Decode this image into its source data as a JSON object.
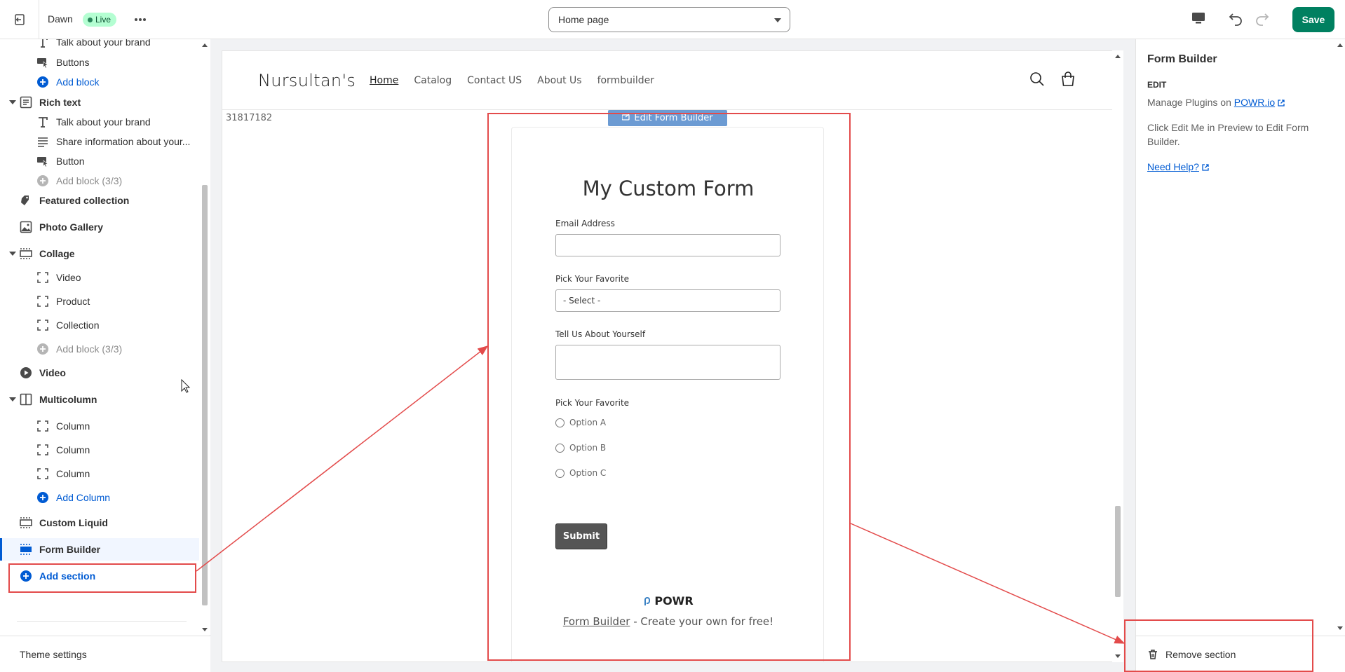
{
  "topbar": {
    "theme_name": "Dawn",
    "live_badge": "Live",
    "page_selector": "Home page",
    "save_label": "Save"
  },
  "sidebar": {
    "items": [
      {
        "label": "Talk about your brand",
        "icon": "text-heading-icon",
        "level": 1
      },
      {
        "label": "Buttons",
        "icon": "button-icon",
        "level": 1
      },
      {
        "label": "Add block",
        "icon": "add-circle-icon",
        "level": 1,
        "kind": "add"
      },
      {
        "label": "Rich text",
        "icon": "rich-text-icon",
        "level": 0,
        "expanded": true
      },
      {
        "label": "Talk about your brand",
        "icon": "text-heading-icon",
        "level": 1
      },
      {
        "label": "Share information about your...",
        "icon": "paragraph-icon",
        "level": 1
      },
      {
        "label": "Button",
        "icon": "button-icon",
        "level": 1
      },
      {
        "label": "Add block (3/3)",
        "icon": "add-circle-icon",
        "level": 1,
        "kind": "disabled"
      },
      {
        "label": "Featured collection",
        "icon": "collection-icon",
        "level": 0
      },
      {
        "label": "Photo Gallery",
        "icon": "image-icon",
        "level": 0
      },
      {
        "label": "Collage",
        "icon": "section-icon",
        "level": 0,
        "expanded": true
      },
      {
        "label": "Video",
        "icon": "block-icon",
        "level": 1
      },
      {
        "label": "Product",
        "icon": "block-icon",
        "level": 1
      },
      {
        "label": "Collection",
        "icon": "block-icon",
        "level": 1
      },
      {
        "label": "Add block (3/3)",
        "icon": "add-circle-icon",
        "level": 1,
        "kind": "disabled"
      },
      {
        "label": "Video",
        "icon": "play-icon",
        "level": 0
      },
      {
        "label": "Multicolumn",
        "icon": "columns-icon",
        "level": 0,
        "expanded": true
      },
      {
        "label": "Column",
        "icon": "block-icon",
        "level": 1
      },
      {
        "label": "Column",
        "icon": "block-icon",
        "level": 1
      },
      {
        "label": "Column",
        "icon": "block-icon",
        "level": 1
      },
      {
        "label": "Add Column",
        "icon": "add-circle-icon",
        "level": 1,
        "kind": "add"
      },
      {
        "label": "Custom Liquid",
        "icon": "section-icon",
        "level": 0
      },
      {
        "label": "Form Builder",
        "icon": "section-icon",
        "level": 0,
        "selected": true
      },
      {
        "label": "Add section",
        "icon": "add-circle-icon",
        "level": 0,
        "kind": "add-section"
      }
    ],
    "theme_settings": "Theme settings"
  },
  "preview": {
    "store_name": "Nursultan's",
    "nav": [
      "Home",
      "Catalog",
      "Contact US",
      "About Us",
      "formbuilder"
    ],
    "app_id": "31817182",
    "edit_tag": "Edit Form Builder",
    "form": {
      "title": "My Custom Form",
      "email_label": "Email Address",
      "favorite_label_1": "Pick Your Favorite",
      "select_value": "- Select -",
      "about_label": "Tell Us About Yourself",
      "favorite_label_2": "Pick Your Favorite",
      "options": [
        "Option A",
        "Option B",
        "Option C"
      ],
      "submit_label": "Submit"
    },
    "powr_brand": "POWR",
    "footer_link": "Form Builder",
    "footer_text": " - Create your own for free!"
  },
  "right_panel": {
    "title": "Form Builder",
    "edit_heading": "EDIT",
    "manage_text": "Manage Plugins on ",
    "manage_link": "POWR.io",
    "instruction": "Click Edit Me in Preview to Edit Form Builder.",
    "help_link": "Need Help?",
    "remove_label": "Remove section"
  },
  "colors": {
    "accent": "#008060",
    "link": "#005bd3",
    "annotation": "#e34b4b",
    "live_badge": "#b4fed2"
  }
}
